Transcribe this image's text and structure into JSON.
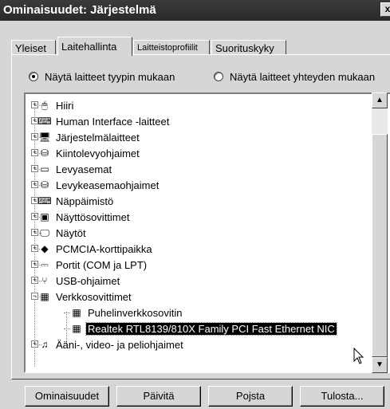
{
  "window": {
    "title": "Ominaisuudet: Järjestelmä",
    "close_button": "x"
  },
  "tabs": [
    {
      "label": "Yleiset",
      "active": false
    },
    {
      "label": "Laitehallinta",
      "active": true
    },
    {
      "label": "Laitteistoprofiilit",
      "active": false
    },
    {
      "label": "Suorituskyky",
      "active": false
    }
  ],
  "view_options": {
    "by_type": {
      "label": "Näytä laitteet tyypin mukaan",
      "checked": true
    },
    "by_connection": {
      "label": "Näytä laitteet yhteyden mukaan",
      "checked": false
    }
  },
  "device_tree": [
    {
      "label": "Hiiri",
      "icon": "mouse-icon",
      "expander": "+"
    },
    {
      "label": "Human Interface -laitteet",
      "icon": "hid-icon",
      "expander": "+"
    },
    {
      "label": "Järjestelmälaitteet",
      "icon": "computer-icon",
      "expander": "+"
    },
    {
      "label": "Kiintolevyohjaimet",
      "icon": "disk-controller-icon",
      "expander": "+"
    },
    {
      "label": "Levyasemat",
      "icon": "disk-drive-icon",
      "expander": "+"
    },
    {
      "label": "Levykeasemaohjaimet",
      "icon": "floppy-controller-icon",
      "expander": "+"
    },
    {
      "label": "Näppäimistö",
      "icon": "keyboard-icon",
      "expander": "+"
    },
    {
      "label": "Näyttösovittimet",
      "icon": "display-adapter-icon",
      "expander": "+"
    },
    {
      "label": "Näytöt",
      "icon": "monitor-icon",
      "expander": "+"
    },
    {
      "label": "PCMCIA-korttipaikka",
      "icon": "pcmcia-icon",
      "expander": "+"
    },
    {
      "label": "Portit (COM ja LPT)",
      "icon": "port-icon",
      "expander": "+"
    },
    {
      "label": "USB-ohjaimet",
      "icon": "usb-icon",
      "expander": "+"
    },
    {
      "label": "Verkkosovittimet",
      "icon": "network-adapter-icon",
      "expander": "−"
    },
    {
      "label": "Puhelinverkkosovitin",
      "icon": "network-adapter-icon",
      "child": true
    },
    {
      "label": "Realtek RTL8139/810X Family PCI Fast Ethernet NIC",
      "icon": "network-adapter-icon",
      "child": true,
      "selected": true
    },
    {
      "label": "Ääni-, video- ja peliohjaimet",
      "icon": "sound-icon",
      "expander": "+"
    }
  ],
  "scrollbar": {
    "up_arrow": "▲",
    "down_arrow": "▼"
  },
  "buttons": {
    "properties": "Ominaisuudet",
    "refresh": "Päivitä",
    "remove": "Pojsta",
    "print": "Tulosta..."
  }
}
